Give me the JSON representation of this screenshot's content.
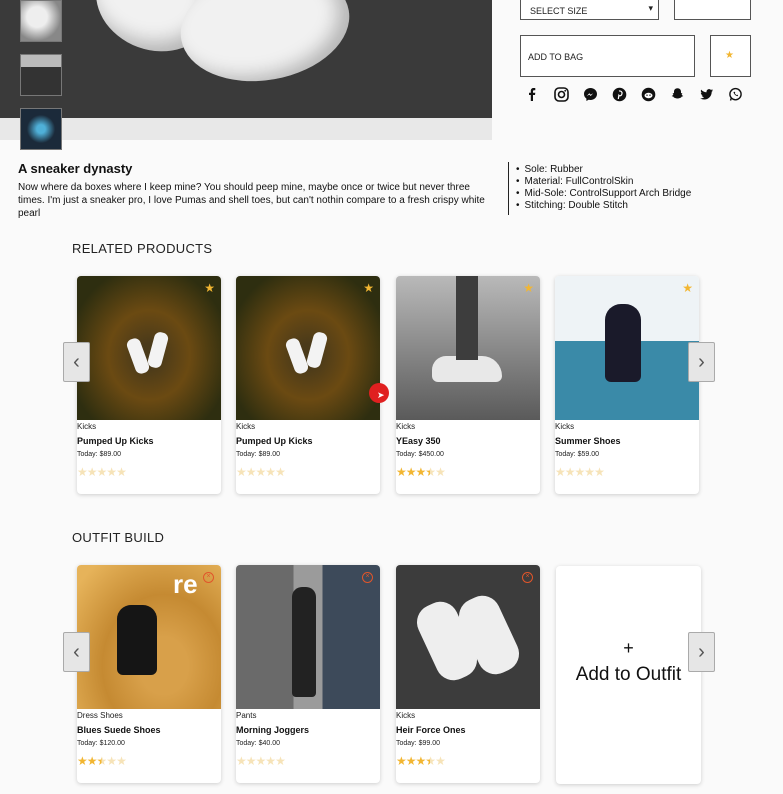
{
  "product": {
    "title": "A sneaker dynasty",
    "description": "Now where da boxes where I keep mine? You should peep mine, maybe once or twice but never three times. I'm just a sneaker pro, I love Pumas and shell toes, but can't nothin compare to a fresh crispy white pearl",
    "features": [
      "Sole: Rubber",
      "Material: FullControlSkin",
      "Mid-Sole: ControlSupport Arch Bridge",
      "Stitching: Double Stitch"
    ]
  },
  "controls": {
    "select_size": "SELECT SIZE",
    "add_to_bag": "ADD TO BAG",
    "fav_icon": "star-icon"
  },
  "social": [
    "facebook-icon",
    "instagram-icon",
    "messenger-icon",
    "pinterest-icon",
    "reddit-icon",
    "snapchat-icon",
    "twitter-icon",
    "whatsapp-icon"
  ],
  "related": {
    "title": "RELATED PRODUCTS",
    "cards": [
      {
        "category": "Kicks",
        "name": "Pumped Up Kicks",
        "price": "Today: $89.00",
        "rating": 0
      },
      {
        "category": "Kicks",
        "name": "Pumped Up Kicks",
        "price": "Today: $89.00",
        "rating": 0
      },
      {
        "category": "Kicks",
        "name": "YEasy 350",
        "price": "Today: $450.00",
        "rating": 3.5
      },
      {
        "category": "Kicks",
        "name": "Summer Shoes",
        "price": "Today: $59.00",
        "rating": 0
      }
    ]
  },
  "outfit": {
    "title": "OUTFIT BUILD",
    "add_plus": "+",
    "add_label": "Add to Outfit",
    "cards": [
      {
        "category": "Dress Shoes",
        "name": "Blues Suede Shoes",
        "price": "Today: $120.00",
        "rating": 2.5
      },
      {
        "category": "Pants",
        "name": "Morning Joggers",
        "price": "Today: $40.00",
        "rating": 0
      },
      {
        "category": "Kicks",
        "name": "Heir Force Ones",
        "price": "Today: $99.00",
        "rating": 3.5
      }
    ]
  },
  "colors": {
    "star": "#f2b632",
    "remove": "#e0562b",
    "cursor": "#e02020"
  }
}
